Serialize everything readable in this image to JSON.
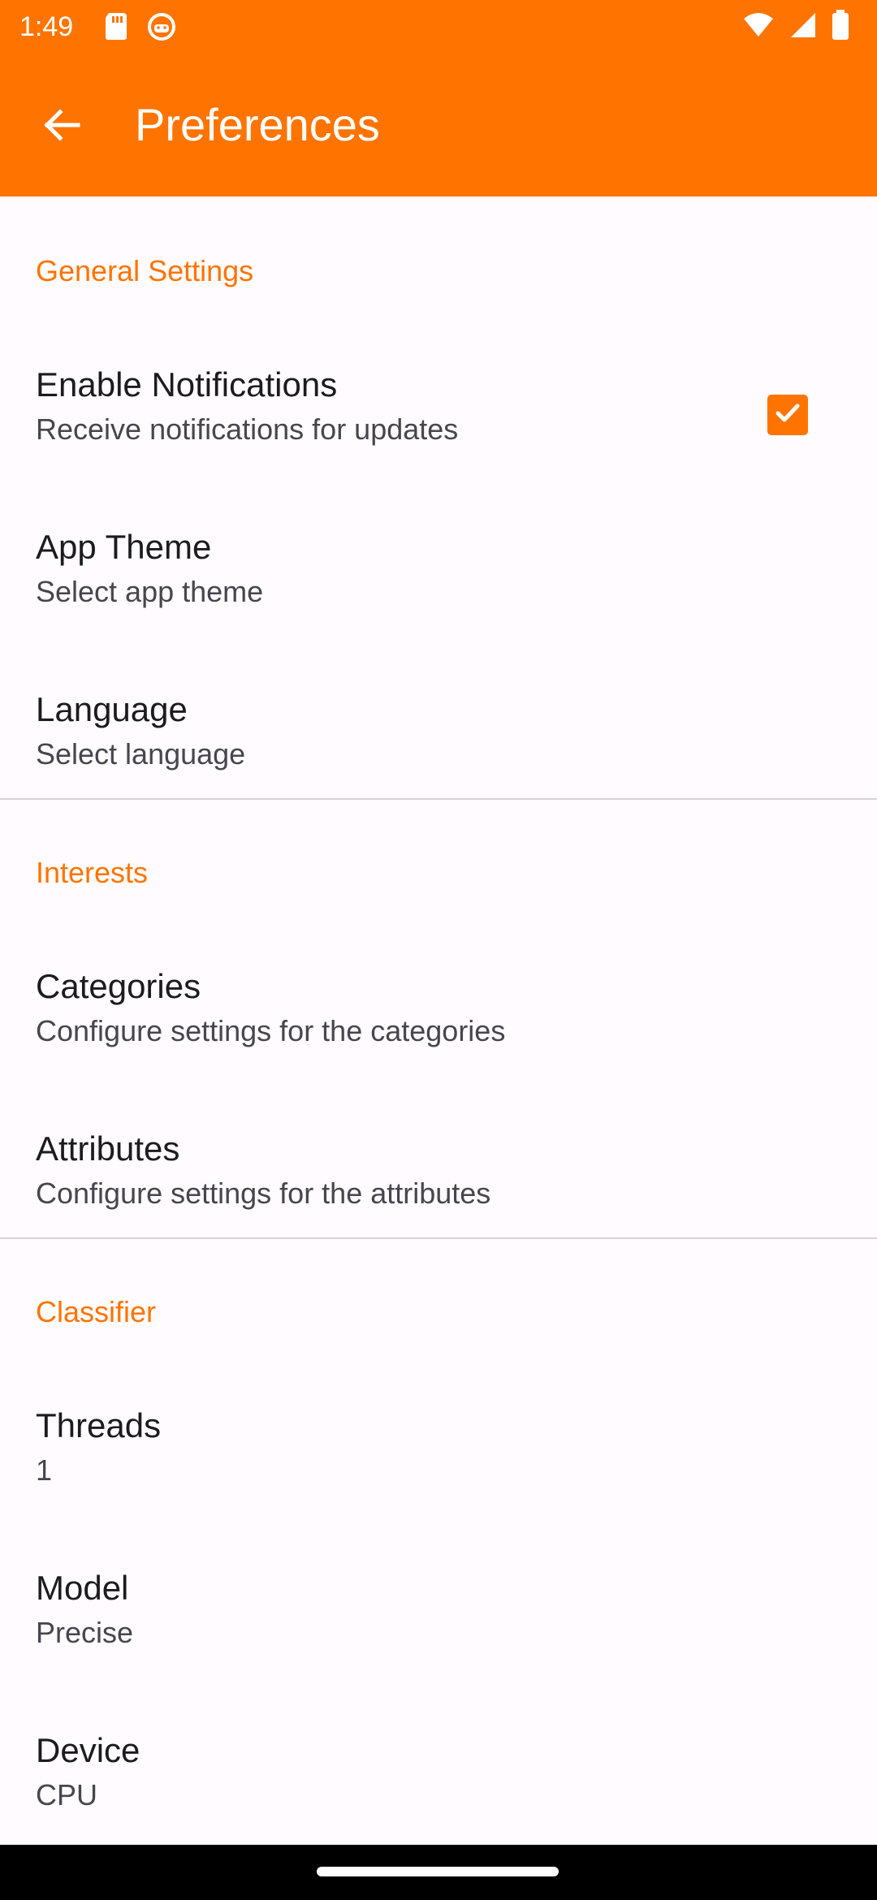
{
  "status_bar": {
    "time": "1:49",
    "left_icons": [
      "sd-card-icon",
      "android-debug-icon"
    ],
    "right_icons": [
      "wifi-icon",
      "signal-icon",
      "battery-icon"
    ]
  },
  "app_bar": {
    "title": "Preferences",
    "back_icon": "arrow-back-icon",
    "background": "#FF7400"
  },
  "sections": {
    "general": {
      "header": "General Settings",
      "notifications": {
        "title": "Enable Notifications",
        "summary": "Receive notifications for updates",
        "checked": true
      },
      "theme": {
        "title": "App Theme",
        "summary": "Select app theme"
      },
      "language": {
        "title": "Language",
        "summary": "Select language"
      }
    },
    "interests": {
      "header": "Interests",
      "categories": {
        "title": "Categories",
        "summary": "Configure settings for the categories"
      },
      "attributes": {
        "title": "Attributes",
        "summary": "Configure settings for the attributes"
      }
    },
    "classifier": {
      "header": "Classifier",
      "threads": {
        "title": "Threads",
        "summary": "1"
      },
      "model": {
        "title": "Model",
        "summary": "Precise"
      },
      "device": {
        "title": "Device",
        "summary": "CPU"
      }
    }
  },
  "colors": {
    "accent": "#FF7400",
    "background": "#FFFBFE",
    "title_text": "#1C1B1F",
    "summary_text": "#49454F"
  }
}
